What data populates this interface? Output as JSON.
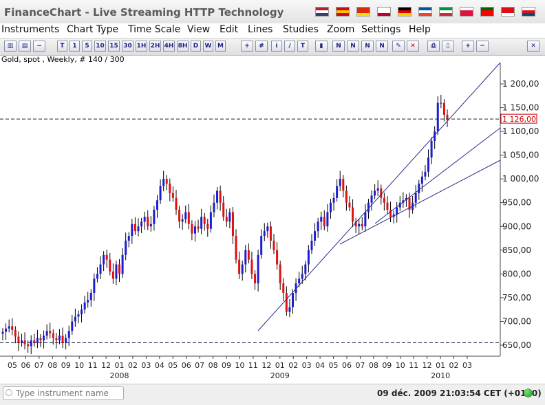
{
  "app_title": "FinanceChart - Live Streaming HTTP Technology",
  "flags": [
    {
      "name": "flag-us-icon",
      "c1": "#b22234",
      "c2": "#ffffff",
      "c3": "#3c3b6e"
    },
    {
      "name": "flag-es-icon",
      "c1": "#c60b1e",
      "c2": "#ffc400",
      "c3": "#c60b1e"
    },
    {
      "name": "flag-cn-icon",
      "c1": "#de2910",
      "c2": "#de2910",
      "c3": "#ffde00"
    },
    {
      "name": "flag-jp-icon",
      "c1": "#ffffff",
      "c2": "#ffffff",
      "c3": "#bc002d"
    },
    {
      "name": "flag-de-icon",
      "c1": "#000000",
      "c2": "#dd0000",
      "c3": "#ffce00"
    },
    {
      "name": "flag-fr-icon",
      "c1": "#0055a4",
      "c2": "#ffffff",
      "c3": "#ef4135"
    },
    {
      "name": "flag-it-icon",
      "c1": "#009246",
      "c2": "#ffffff",
      "c3": "#ce2b37"
    },
    {
      "name": "flag-pl-icon",
      "c1": "#ffffff",
      "c2": "#dc143c",
      "c3": "#dc143c"
    },
    {
      "name": "flag-pt-icon",
      "c1": "#006600",
      "c2": "#ff0000",
      "c3": "#ff0000"
    },
    {
      "name": "flag-tr-icon",
      "c1": "#e30a17",
      "c2": "#e30a17",
      "c3": "#ffffff"
    },
    {
      "name": "flag-cz-icon",
      "c1": "#ffffff",
      "c2": "#d7141a",
      "c3": "#11457e"
    }
  ],
  "menu": [
    "Instruments",
    "Chart Type",
    "Time Scale",
    "View",
    "Edit",
    "Lines",
    "Studies",
    "Zoom",
    "Settings",
    "Help"
  ],
  "toolbar": {
    "timeframes": [
      "T",
      "1",
      "5",
      "10",
      "15",
      "30",
      "1H",
      "2H",
      "4H",
      "8H",
      "D",
      "W",
      "M"
    ]
  },
  "info_label": "Gold, spot , Weekly, # 140 / 300",
  "status": {
    "search_placeholder": "Type instrument name",
    "datetime": "09 déc. 2009 21:03:54  CET (+0100)"
  },
  "colors": {
    "up": "#1c1cd6",
    "down": "#e01010",
    "trend": "#2a2a8c",
    "last_price": "#cc0000"
  },
  "chart_data": {
    "type": "candlestick",
    "ylim": [
      630,
      1235
    ],
    "yticks": [
      650,
      700,
      750,
      800,
      850,
      900,
      950,
      1000,
      1050,
      1100,
      1150,
      1200
    ],
    "ytick_labels": [
      "650,00",
      "700,00",
      "750,00",
      "800,00",
      "850,00",
      "900,00",
      "950,00",
      "1 000,00",
      "1 050,00",
      "1 100,00",
      "1 150,00",
      "1 200,00"
    ],
    "last_price": 1126,
    "last_price_label": "1 126,00",
    "support_level": 655,
    "x_tick_labels": [
      "05",
      "06",
      "07",
      "08",
      "09",
      "10",
      "11",
      "12",
      "01",
      "02",
      "03",
      "04",
      "05",
      "06",
      "07",
      "08",
      "09",
      "10",
      "11",
      "12",
      "01",
      "02",
      "03",
      "04",
      "05",
      "06",
      "07",
      "08",
      "09",
      "10",
      "11",
      "12",
      "01",
      "02",
      "03"
    ],
    "year_labels": [
      {
        "label": "2008",
        "tick_index": 8
      },
      {
        "label": "2009",
        "tick_index": 20
      },
      {
        "label": "2010",
        "tick_index": 32
      }
    ],
    "closes": [
      678,
      685,
      690,
      682,
      668,
      655,
      660,
      652,
      648,
      660,
      655,
      665,
      660,
      670,
      680,
      675,
      665,
      660,
      670,
      655,
      665,
      680,
      700,
      710,
      715,
      725,
      740,
      745,
      760,
      790,
      800,
      820,
      840,
      830,
      805,
      790,
      820,
      800,
      840,
      870,
      880,
      905,
      890,
      900,
      910,
      920,
      900,
      905,
      935,
      955,
      985,
      1000,
      990,
      970,
      960,
      935,
      910,
      915,
      930,
      905,
      885,
      900,
      895,
      920,
      905,
      895,
      930,
      950,
      975,
      950,
      920,
      910,
      930,
      880,
      830,
      800,
      820,
      850,
      830,
      800,
      780,
      840,
      880,
      890,
      900,
      870,
      850,
      820,
      780,
      760,
      720,
      730,
      760,
      780,
      790,
      800,
      820,
      850,
      870,
      890,
      910,
      920,
      900,
      930,
      950,
      960,
      985,
      1000,
      975,
      950,
      940,
      910,
      900,
      905,
      900,
      930,
      950,
      965,
      975,
      980,
      960,
      950,
      935,
      920,
      925,
      940,
      950,
      955,
      960,
      935,
      950,
      970,
      990,
      1005,
      1015,
      1045,
      1080,
      1100,
      1160,
      1160,
      1135,
      1126
    ]
  }
}
